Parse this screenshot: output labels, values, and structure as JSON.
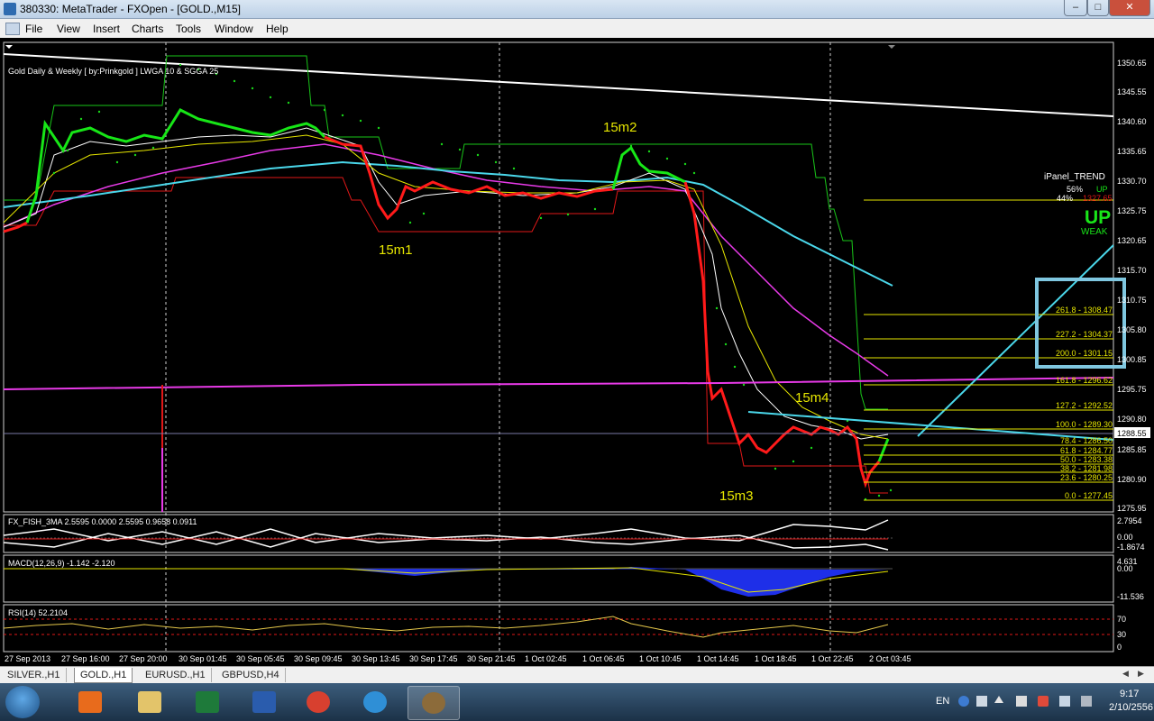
{
  "window": {
    "title": "380330: MetaTrader - FXOpen - [GOLD.,M15]"
  },
  "menu": [
    "File",
    "View",
    "Insert",
    "Charts",
    "Tools",
    "Window",
    "Help"
  ],
  "chart": {
    "indicator_title": "Gold Daily & Weekly [ by:Prinkgold ]  LWGA 10  &  SGGA 25",
    "price_ticks": [
      "1350.65",
      "1345.55",
      "1340.60",
      "1335.65",
      "1330.70",
      "1325.75",
      "1320.65",
      "1315.70",
      "1310.75",
      "1305.80",
      "1300.85",
      "1295.75",
      "1290.80",
      "1285.85",
      "1280.90",
      "1275.95"
    ],
    "current_price": "1288.55",
    "time_ticks": [
      "27 Sep 2013",
      "27 Sep 16:00",
      "27 Sep 20:00",
      "30 Sep 01:45",
      "30 Sep 05:45",
      "30 Sep 09:45",
      "30 Sep 13:45",
      "30 Sep 17:45",
      "30 Sep 21:45",
      "1 Oct 02:45",
      "1 Oct 06:45",
      "1 Oct 10:45",
      "1 Oct 14:45",
      "1 Oct 18:45",
      "1 Oct 22:45",
      "2 Oct 03:45"
    ],
    "wave_labels": [
      "15m1",
      "15m2",
      "15m3",
      "15m4"
    ],
    "fib_levels": [
      "261.8 - 1308.47",
      "227.2 - 1304.37",
      "200.0 - 1301.15",
      "161.8 - 1296.62",
      "127.2 - 1292.52",
      "100.0 - 1289.30",
      "78.4 - 1286.50",
      "61.8 - 1284.77",
      "50.0 - 1283.38",
      "38.2 - 1281.98",
      "23.6 - 1280.25",
      "0.0 - 1277.45"
    ],
    "ipanel": {
      "title": "iPanel_TREND",
      "row1_left": "56%",
      "row1_right": "UP",
      "row2_left": "44%",
      "row2_right": "1327.65",
      "big_trend": "UP",
      "strength": "WEAK"
    },
    "subwindows": {
      "fish": {
        "label": "FX_FISH_3MA 2.5595 0.0000 2.5595 0.9658 0.0911",
        "ticks": [
          "2.7954",
          "0.00",
          "-1.8674"
        ]
      },
      "macd": {
        "label": "MACD(12,26,9) -1.142 -2.120",
        "ticks": [
          "4.631",
          "0.00",
          "-11.536"
        ]
      },
      "rsi": {
        "label": "RSI(14) 52.2104",
        "ticks": [
          "70",
          "30",
          "0"
        ]
      }
    },
    "colors": {
      "bull": "#00ff00",
      "bear": "#ff0000",
      "ma_slow": "#00c8ff",
      "ma_purple": "#ff00ff",
      "fib": "#ffff00",
      "trend": "#00e5ff"
    }
  },
  "tabs": [
    "SILVER.,H1",
    "GOLD.,H1",
    "EURUSD.,H1",
    "GBPUSD,H4"
  ],
  "active_tab": "GOLD.,H1",
  "taskbar": {
    "apps": [
      "media-player",
      "file-explorer",
      "excel",
      "word",
      "chrome",
      "internet-explorer",
      "metatrader"
    ]
  },
  "tray": {
    "lang": "EN",
    "time": "9:17",
    "date": "2/10/2556"
  }
}
